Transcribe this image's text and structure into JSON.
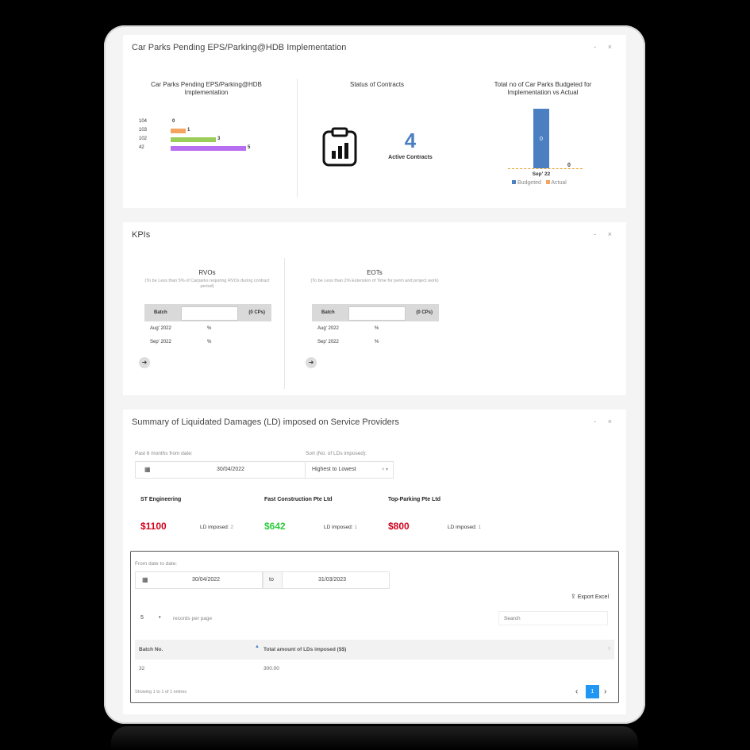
{
  "panel1": {
    "title": "Car Parks Pending EPS/Parking@HDB Implementation",
    "controls": "- ×",
    "pending_chart": {
      "title": "Car Parks Pending EPS/Parking@HDB Implementation",
      "bars": [
        {
          "label": "104",
          "value": 0,
          "color": "#4a7fc1"
        },
        {
          "label": "103",
          "value": 1,
          "color": "#f4a460"
        },
        {
          "label": "102",
          "value": 3,
          "color": "#9acd5a"
        },
        {
          "label": "42",
          "value": 5,
          "color": "#b86ef0"
        }
      ]
    },
    "contracts": {
      "title": "Status of Contracts",
      "count": "4",
      "label": "Active Contracts",
      "icon": "clipboard-chart-icon"
    },
    "budget_chart": {
      "title": "Total no of Car Parks Budgeted for Implementation vs Actual",
      "category": "Sep' 22",
      "budgeted_value": "0",
      "actual_value": "0",
      "legend": [
        {
          "name": "Budgeted",
          "color": "#4a7fc1"
        },
        {
          "name": "Actual",
          "color": "#f4a460"
        }
      ]
    }
  },
  "panel2": {
    "title": "KPIs",
    "controls": "- ×",
    "rvo": {
      "title": "RVOs",
      "note": "(To be Less than 5% of Carparks requiring RVOs during contract period)",
      "batch": "Batch",
      "cps": "(0 CPs)",
      "rows": [
        {
          "month": "Aug' 2022",
          "value": "%"
        },
        {
          "month": "Sep' 2022",
          "value": "%"
        }
      ],
      "arrow": "➜"
    },
    "eot": {
      "title": "EOTs",
      "note": "(To be Less than 2% Extension of Time for perm and project work)",
      "batch": "Batch",
      "cps": "(0 CPs)",
      "rows": [
        {
          "month": "Aug' 2022",
          "value": "%"
        },
        {
          "month": "Sep' 2022",
          "value": "%"
        }
      ],
      "arrow": "➜"
    }
  },
  "panel3": {
    "title": "Summary of Liquidated Damages (LD) imposed on Service Providers",
    "controls": "- ×",
    "past_label": "Past 6 months from date:",
    "past_date": "30/04/2022",
    "sort_label": "Sort (No. of LDs imposed):",
    "sort_value": "Highest to Lowest",
    "sort_controls": "× ▾",
    "providers": [
      {
        "name": "ST Engineering",
        "amount": "$1100",
        "ld_label": "LD imposed:",
        "ld_count": "2",
        "color": "#d0021b"
      },
      {
        "name": "Fast Construction Pte Ltd",
        "amount": "$642",
        "ld_label": "LD imposed:",
        "ld_count": "1",
        "color": "#2ecc40"
      },
      {
        "name": "Top-Parking Pte Ltd",
        "amount": "$800",
        "ld_label": "LD imposed:",
        "ld_count": "1",
        "color": "#d0021b"
      }
    ],
    "table": {
      "range_label": "From date to date:",
      "from": "30/04/2022",
      "to_label": "to",
      "to": "31/03/2023",
      "export": "Export Excel",
      "page_size": "5",
      "page_size_suffix": "▾",
      "records_label": "records per page",
      "search_placeholder": "Search",
      "columns": [
        "Batch No.",
        "Total amount of LDs imposed ($$)"
      ],
      "rows": [
        [
          "32",
          "300.00"
        ]
      ],
      "info": "Showing 1 to 1 of 1 entries",
      "page": "1",
      "prev": "‹",
      "next": "›"
    }
  }
}
